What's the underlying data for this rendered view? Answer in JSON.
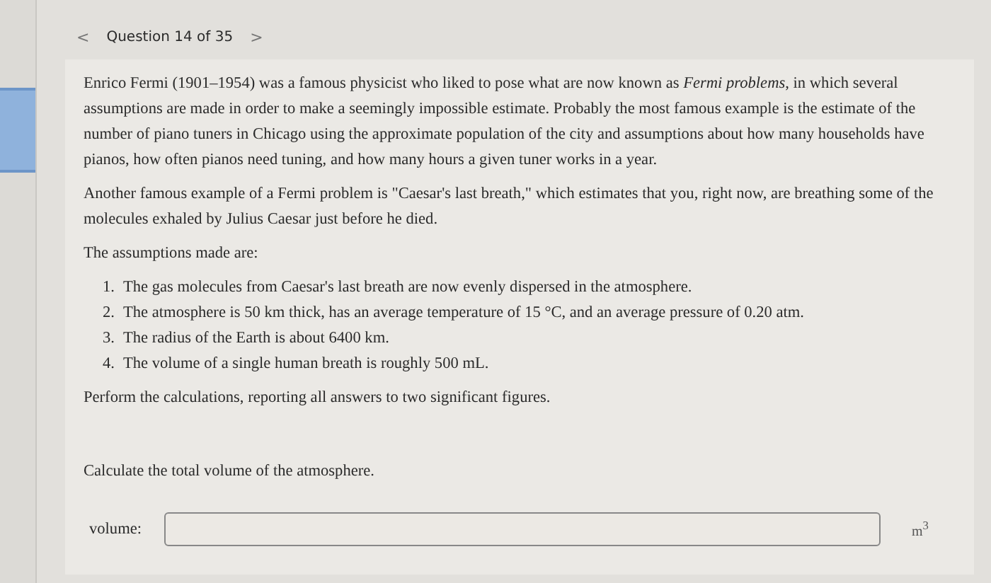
{
  "header": {
    "prev": "<",
    "title": "Question 14 of 35",
    "next": ">"
  },
  "paragraphs": [
    "Enrico Fermi (1901–1954) was a famous physicist who liked to pose what are now known as *Fermi problems*, in which several assumptions are made in order to make a seemingly impossible estimate. Probably the most famous example is the estimate of the number of piano tuners in Chicago using the approximate population of the city and assumptions about how many households have pianos, how often pianos need tuning, and how many hours a given tuner works in a year.",
    "Another famous example of a Fermi problem is \"Caesar's last breath,\" which estimates that you, right now, are breathing some of the molecules exhaled by Julius Caesar just before he died.",
    "The assumptions made are:"
  ],
  "assumptions": [
    {
      "number": "1.",
      "text": "The gas molecules from Caesar's last breath are now evenly dispersed in the atmosphere."
    },
    {
      "number": "2.",
      "text": "The atmosphere is 50 km thick, has an average temperature of 15 °C, and an average pressure of 0.20 atm."
    },
    {
      "number": "3.",
      "text": "The radius of the Earth is about 6400 km."
    },
    {
      "number": "4.",
      "text": "The volume of a single human breath is roughly 500 mL."
    }
  ],
  "instruction": "Perform the calculations, reporting all answers to two significant figures.",
  "question": "Calculate the total volume of the atmosphere.",
  "answer": {
    "label": "volume:",
    "unit": "m$^{3}$"
  }
}
